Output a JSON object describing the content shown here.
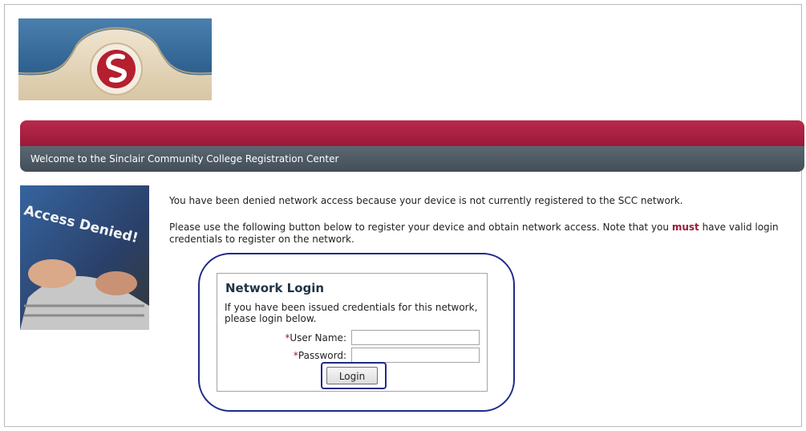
{
  "header": {
    "welcome": "Welcome to the Sinclair Community College Registration Center"
  },
  "images": {
    "denied_text": "Access Denied!"
  },
  "messages": {
    "denied": "You have been denied network access because your device is not currently registered to the SCC network.",
    "instructions_before": "Please use the following button below to register your device and obtain network access. Note that you ",
    "instructions_emphasis": "must",
    "instructions_after": " have valid login credentials to register on the network."
  },
  "login": {
    "title": "Network Login",
    "description": "If you have been issued credentials for this network, please login below.",
    "required_mark": "*",
    "username_label": "User Name:",
    "password_label": "Password:",
    "username_value": "",
    "password_value": "",
    "button_label": "Login"
  },
  "colors": {
    "brand_red": "#9c1838",
    "header_gray": "#434e58",
    "annotation_blue": "#1f2a8a"
  }
}
